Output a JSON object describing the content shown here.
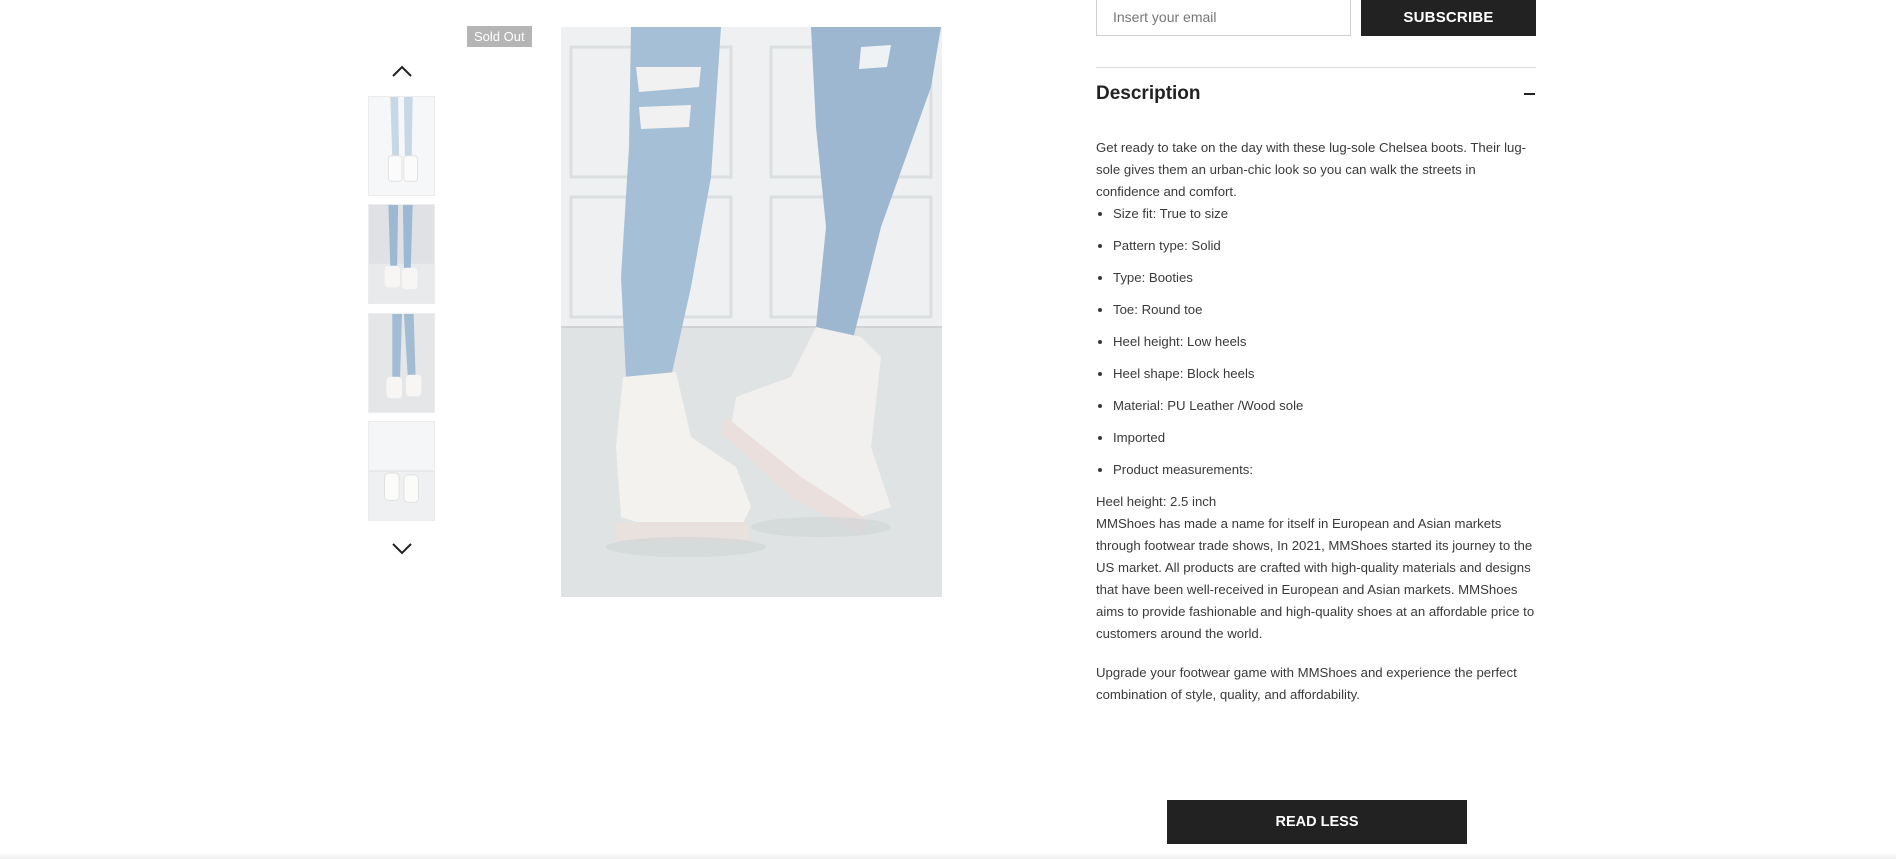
{
  "gallery": {
    "badge": "Sold Out",
    "nav_up_icon": "chevron-up-icon",
    "nav_down_icon": "chevron-down-icon"
  },
  "newsletter": {
    "email_placeholder": "Insert your email",
    "subscribe_label": "SUBSCRIBE"
  },
  "description": {
    "title": "Description",
    "toggle_icon": "minus-icon",
    "intro": "Get ready to take on the day with these lug-sole Chelsea boots. Their lug-sole gives them an urban-chic look so you can walk the streets in confidence and comfort.",
    "specs": [
      "Size fit: True to size",
      "Pattern type: Solid",
      "Type: Booties",
      "Toe: Round toe",
      "Heel height: Low heels",
      "Heel shape: Block heels",
      "Material: PU Leather /Wood sole",
      "Imported",
      "Product measurements:"
    ],
    "measurement": "Heel height: 2.5 inch",
    "brand_paragraph": "MMShoes has made a name for itself in European and Asian markets through footwear trade shows, In 2021, MMShoes started its journey to the US market. All products are crafted with high-quality materials and designs that have been well-received in European and Asian markets. MMShoes aims to provide fashionable and high-quality shoes at an affordable price to customers around the world.",
    "closing_paragraph": "Upgrade your footwear game with MMShoes and experience the perfect combination of style, quality, and affordability.",
    "read_less_label": "READ LESS"
  },
  "colors": {
    "button_dark": "#222222",
    "badge_gray": "#b5b5b5",
    "denim": "#9fb9d3",
    "boot_white": "#f3f1ef"
  }
}
